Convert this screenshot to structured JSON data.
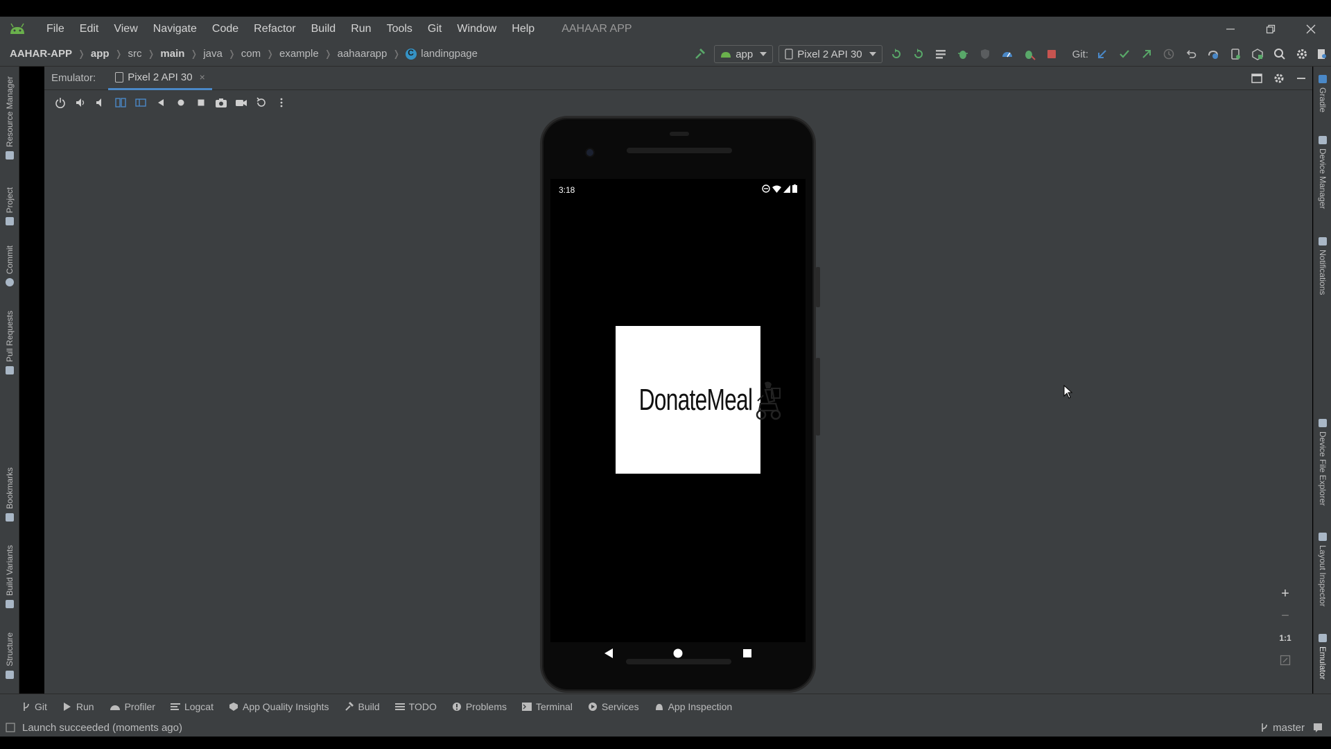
{
  "menubar": {
    "items": [
      "File",
      "Edit",
      "View",
      "Navigate",
      "Code",
      "Refactor",
      "Build",
      "Run",
      "Tools",
      "Git",
      "Window",
      "Help"
    ],
    "app_title": "AAHAAR APP"
  },
  "breadcrumb": {
    "project": "AAHAR-APP",
    "module": "app",
    "parts": [
      "src",
      "main",
      "java",
      "com",
      "example",
      "aahaarapp"
    ],
    "file": "landingpage"
  },
  "toolbar": {
    "run_config": "app",
    "device": "Pixel 2 API 30",
    "git_label": "Git:"
  },
  "emulator": {
    "label": "Emulator:",
    "tab": "Pixel 2 API 30",
    "close": "×"
  },
  "phone": {
    "time": "3:18",
    "splash_text": "DonateMeal"
  },
  "left_tabs": [
    "Resource Manager",
    "Project",
    "Commit",
    "Pull Requests",
    "Bookmarks",
    "Build Variants",
    "Structure"
  ],
  "right_tabs": [
    "Gradle",
    "Device Manager",
    "Notifications",
    "Device File Explorer",
    "Layout Inspector",
    "Emulator"
  ],
  "bottom_tools": [
    "Git",
    "Run",
    "Profiler",
    "Logcat",
    "App Quality Insights",
    "Build",
    "TODO",
    "Problems",
    "Terminal",
    "Services",
    "App Inspection"
  ],
  "status": {
    "message": "Launch succeeded (moments ago)",
    "branch": "master"
  },
  "zoom": {
    "plus": "+",
    "minus": "−",
    "one_to_one": "1:1"
  },
  "colors": {
    "ide_bg": "#3c3f41",
    "accent": "#4a88c7",
    "run_green": "#59a869",
    "stop_red": "#c75450"
  }
}
